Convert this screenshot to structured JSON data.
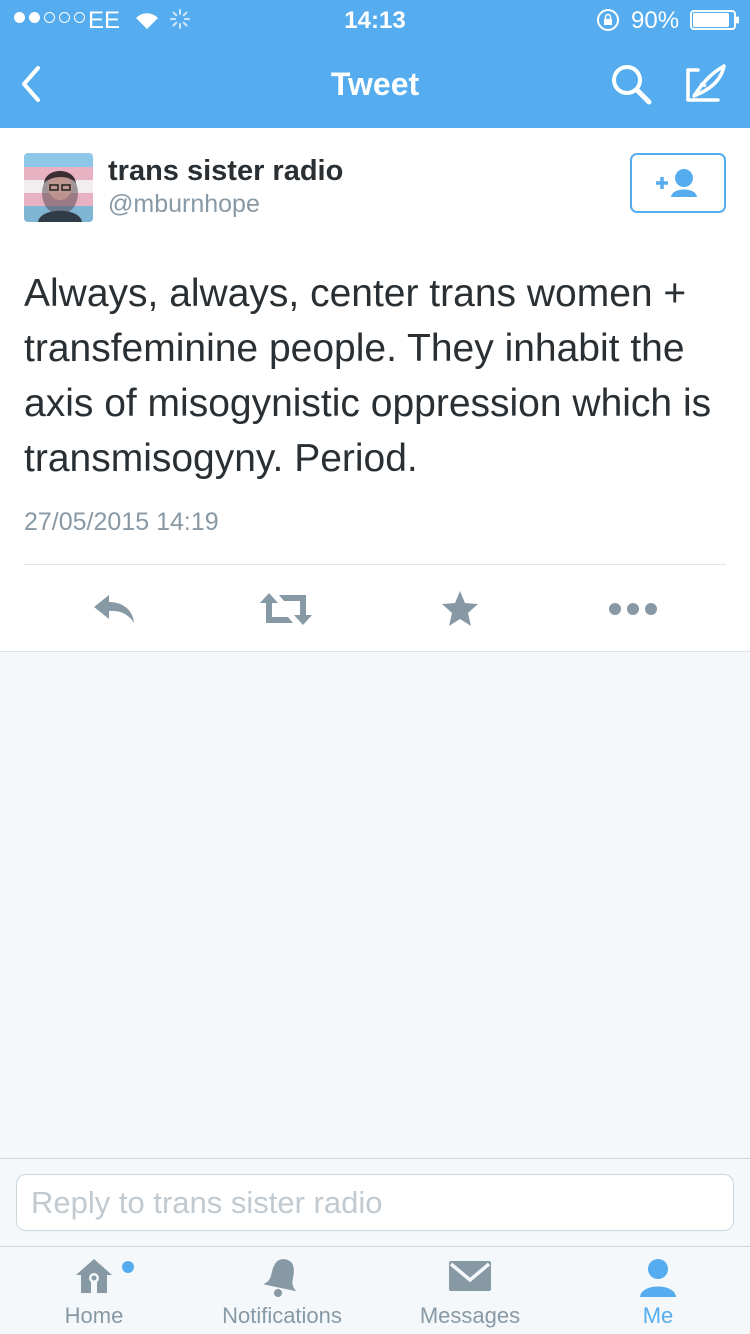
{
  "status_bar": {
    "carrier": "EE",
    "time": "14:13",
    "battery_percent": "90%",
    "battery_level": 0.9
  },
  "nav": {
    "title": "Tweet"
  },
  "tweet": {
    "author_name": "trans sister radio",
    "author_handle": "@mburnhope",
    "text": "Always, always, center trans women + transfeminine people. They inhabit the axis of misogynistic oppression which is transmisogyny. Period.",
    "timestamp": "27/05/2015 14:19"
  },
  "reply": {
    "placeholder": "Reply to trans sister radio"
  },
  "tabs": [
    {
      "label": "Home",
      "icon": "home-icon"
    },
    {
      "label": "Notifications",
      "icon": "bell-icon"
    },
    {
      "label": "Messages",
      "icon": "envelope-icon"
    },
    {
      "label": "Me",
      "icon": "person-icon"
    }
  ],
  "colors": {
    "brand": "#55acee",
    "text": "#292f33",
    "secondary_text": "#8899a6",
    "action_icon": "#8899a6",
    "background": "#f5f8fa"
  }
}
